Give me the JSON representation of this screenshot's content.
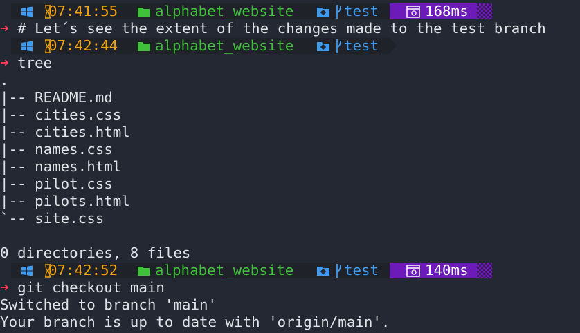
{
  "colors": {
    "background": "#232832",
    "text": "#dfe2e7",
    "time": "#f0a30a",
    "folder": "#3fc13a",
    "branch": "#3f9bf0",
    "duration_bg": "#6c1bb8",
    "arrow": "#ff3b5c"
  },
  "prompts": [
    {
      "time": "07:41:55",
      "folder": "alphabet_website",
      "branch": "test",
      "duration": "168ms"
    },
    {
      "time": "07:42:44",
      "folder": "alphabet_website",
      "branch": "test",
      "duration": ""
    },
    {
      "time": "07:42:52",
      "folder": "alphabet_website",
      "branch": "test",
      "duration": "140ms"
    }
  ],
  "commands": [
    "# Let´s see the extent of the changes made to the test branch",
    "tree",
    "git checkout main"
  ],
  "prompt_symbol": "➜",
  "tree_output": {
    "root": ".",
    "entries": [
      "|-- README.md",
      "|-- cities.css",
      "|-- cities.html",
      "|-- names.css",
      "|-- names.html",
      "|-- pilot.css",
      "|-- pilots.html",
      "`-- site.css"
    ],
    "blank": "",
    "summary": "0 directories, 8 files"
  },
  "checkout_output": [
    "Switched to branch 'main'",
    "Your branch is up to date with 'origin/main'."
  ],
  "icons": {
    "os": "windows-logo-icon",
    "clock": "hourglass-icon",
    "folder": "folder-icon",
    "git": "git-repo-icon",
    "branch": "git-branch-icon",
    "timer": "stopwatch-icon"
  }
}
